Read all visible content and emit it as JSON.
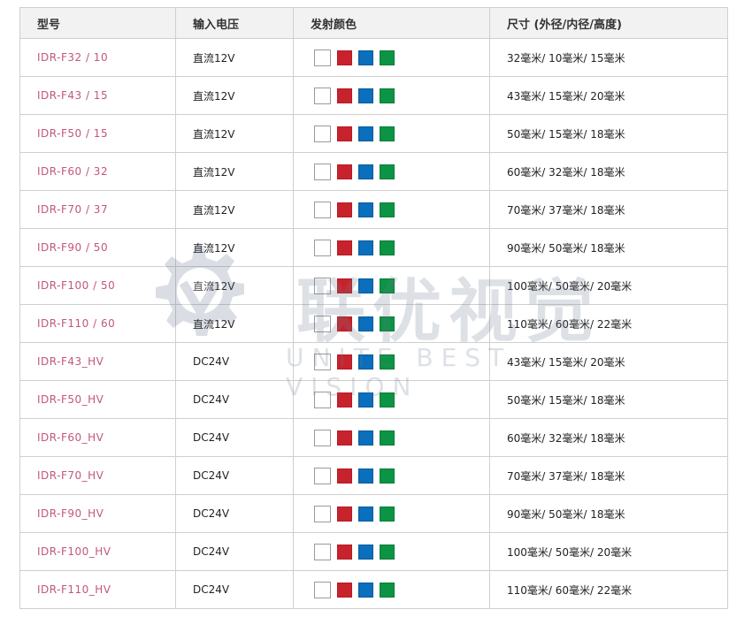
{
  "headers": {
    "model": "型号",
    "voltage": "输入电压",
    "colors": "发射颜色",
    "size": "尺寸 (外径/内径/高度)"
  },
  "swatch_colors": {
    "white": "#ffffff",
    "red": "#c8232d",
    "blue": "#0a6fbd",
    "green": "#0b9444"
  },
  "rows": [
    {
      "model": "IDR-F32 / 10",
      "voltage": "直流12V",
      "size": "32毫米/ 10毫米/ 15毫米"
    },
    {
      "model": "IDR-F43 / 15",
      "voltage": "直流12V",
      "size": "43毫米/ 15毫米/ 20毫米"
    },
    {
      "model": "IDR-F50 / 15",
      "voltage": "直流12V",
      "size": "50毫米/ 15毫米/ 18毫米"
    },
    {
      "model": "IDR-F60 / 32",
      "voltage": "直流12V",
      "size": "60毫米/ 32毫米/ 18毫米"
    },
    {
      "model": "IDR-F70 / 37",
      "voltage": "直流12V",
      "size": "70毫米/ 37毫米/ 18毫米"
    },
    {
      "model": "IDR-F90 / 50",
      "voltage": "直流12V",
      "size": "90毫米/ 50毫米/ 18毫米"
    },
    {
      "model": "IDR-F100 / 50",
      "voltage": "直流12V",
      "size": "100毫米/ 50毫米/ 20毫米"
    },
    {
      "model": "IDR-F110 / 60",
      "voltage": "直流12V",
      "size": "110毫米/ 60毫米/ 22毫米"
    },
    {
      "model": "IDR-F43_HV",
      "voltage": "DC24V",
      "size": "43毫米/ 15毫米/ 20毫米"
    },
    {
      "model": "IDR-F50_HV",
      "voltage": "DC24V",
      "size": "50毫米/ 15毫米/ 18毫米"
    },
    {
      "model": "IDR-F60_HV",
      "voltage": "DC24V",
      "size": "60毫米/ 32毫米/ 18毫米"
    },
    {
      "model": "IDR-F70_HV",
      "voltage": "DC24V",
      "size": "70毫米/ 37毫米/ 18毫米"
    },
    {
      "model": "IDR-F90_HV",
      "voltage": "DC24V",
      "size": "90毫米/ 50毫米/ 18毫米"
    },
    {
      "model": "IDR-F100_HV",
      "voltage": "DC24V",
      "size": "100毫米/ 50毫米/ 20毫米"
    },
    {
      "model": "IDR-F110_HV",
      "voltage": "DC24V",
      "size": "110毫米/ 60毫米/ 22毫米"
    }
  ],
  "watermark": {
    "title": "联优视觉",
    "subtitle": "UNITE BEST VISION"
  }
}
